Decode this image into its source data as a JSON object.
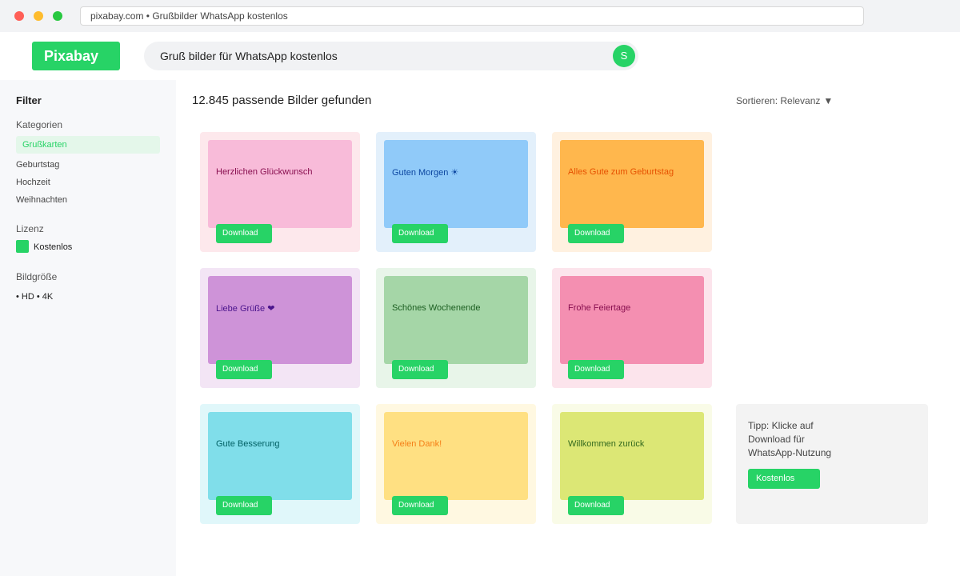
{
  "browser": {
    "url": "pixabay.com • Grußbilder WhatsApp kostenlos"
  },
  "header": {
    "logo": "Pixabay",
    "search_value": "Gruß bilder für WhatsApp kostenlos",
    "search_button": "S"
  },
  "sidebar": {
    "title": "Filter",
    "categories_heading": "Kategorien",
    "categories": [
      "Grußkarten",
      "Geburtstag",
      "Hochzeit",
      "Weihnachten"
    ],
    "license_heading": "Lizenz",
    "license_option": "Kostenlos",
    "size_heading": "Bildgröße",
    "size_options": "• HD • 4K"
  },
  "main": {
    "results_count": "12.845 passende Bilder gefunden",
    "sort_label": "Sortieren: Relevanz",
    "sort_icon": "▼",
    "download_label": "Download",
    "cards": [
      {
        "label": "Herzlichen Glückwunsch",
        "bg": "#fde8ec",
        "thumb": "#f8bbd9",
        "text": "#880e4f"
      },
      {
        "label": "Guten Morgen ☀",
        "bg": "#e3f0fb",
        "thumb": "#90caf9",
        "text": "#0d47a1"
      },
      {
        "label": "Alles Gute zum Geburtstag",
        "bg": "#fff1e0",
        "thumb": "#ffb74d",
        "text": "#e65100"
      },
      {
        "label": "Liebe Grüße ❤",
        "bg": "#f3e5f5",
        "thumb": "#ce93d8",
        "text": "#4a148c"
      },
      {
        "label": "Schönes Wochenende",
        "bg": "#e8f5e9",
        "thumb": "#a5d6a7",
        "text": "#1b5e20"
      },
      {
        "label": "Frohe Feiertage",
        "bg": "#fce4ec",
        "thumb": "#f48fb1",
        "text": "#880e4f"
      },
      {
        "label": "Gute Besserung",
        "bg": "#e0f7fa",
        "thumb": "#80deea",
        "text": "#006064"
      },
      {
        "label": "Vielen Dank!",
        "bg": "#fff8e1",
        "thumb": "#ffe082",
        "text": "#f57f17"
      },
      {
        "label": "Willkommen zurück",
        "bg": "#f9fbe7",
        "thumb": "#dce775",
        "text": "#33691e"
      }
    ]
  },
  "tip": {
    "text": "Tipp: Klicke auf Download für WhatsApp-Nutzung",
    "button": "Kostenlos"
  },
  "colors": {
    "accent": "#27d366"
  }
}
